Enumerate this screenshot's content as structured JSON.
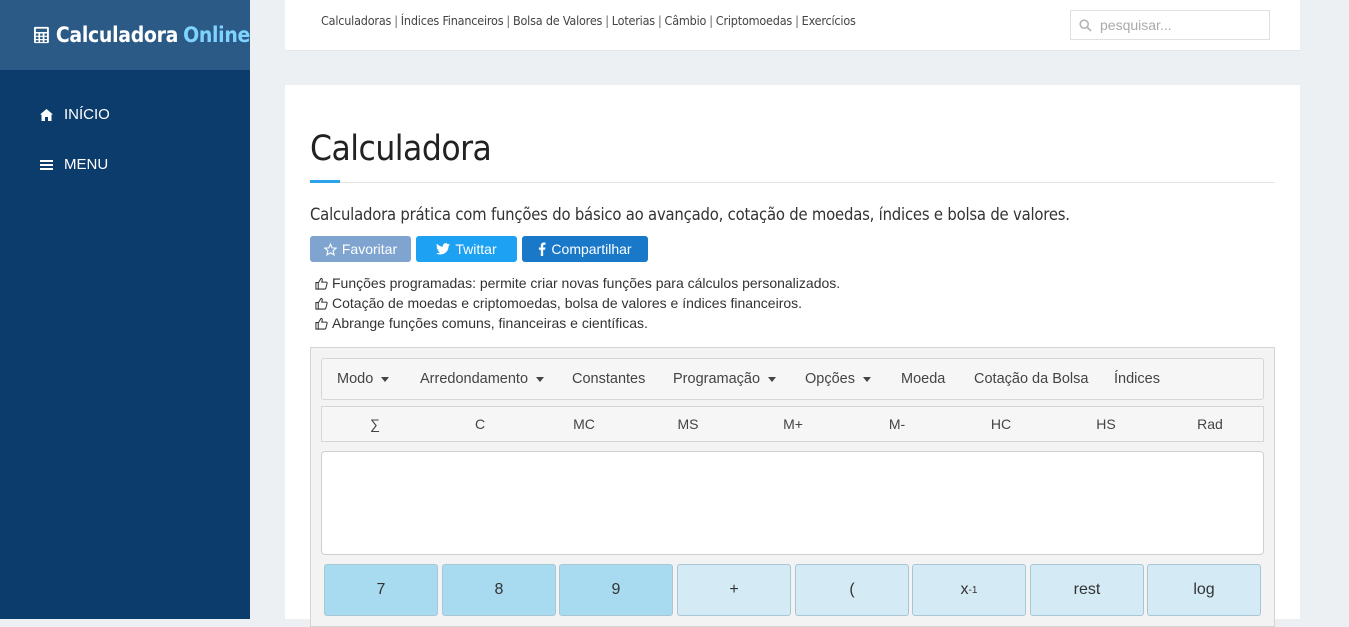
{
  "brand": {
    "name": "Calculadora",
    "accent": "Online"
  },
  "sidebar": {
    "items": [
      {
        "label": "INÍCIO",
        "icon": "home-icon"
      },
      {
        "label": "MENU",
        "icon": "hamburger-icon"
      }
    ]
  },
  "topnav": {
    "links": [
      "Calculadoras",
      "Índices Financeiros",
      "Bolsa de Valores",
      "Loterias",
      "Câmbio",
      "Criptomoedas",
      "Exercícios"
    ]
  },
  "search": {
    "placeholder": "pesquisar..."
  },
  "main": {
    "title": "Calculadora",
    "subtitle": "Calculadora prática com funções do básico ao avançado, cotação de moedas, índices e bolsa de valores.",
    "buttons": {
      "favorite": "Favoritar",
      "twitter": "Twittar",
      "share": "Compartilhar"
    },
    "features": [
      "Funções programadas: permite criar novas funções para cálculos personalizados.",
      "Cotação de moedas e criptomoedas, bolsa de valores e índices financeiros.",
      "Abrange funções comuns, financeiras e científicas."
    ]
  },
  "calculator": {
    "menu": [
      "Modo",
      "Arredondamento",
      "Constantes",
      "Programação",
      "Opções",
      "Moeda",
      "Cotação da Bolsa",
      "Índices"
    ],
    "memory": [
      "∑",
      "C",
      "MC",
      "MS",
      "M+",
      "M-",
      "HC",
      "HS",
      "Rad"
    ],
    "display": "",
    "keys": {
      "k7": "7",
      "k8": "8",
      "k9": "9",
      "plus": "+",
      "paren": "(",
      "inv_base": "x",
      "inv_exp": "-1",
      "rest": "rest",
      "log": "log"
    }
  },
  "colors": {
    "sidebar": "#0c3c6c",
    "logo_bg": "#2c5a86",
    "brand_accent": "#7fd3ff",
    "title_accent": "#2aa3e8",
    "favorite_btn": "#7ea4cf",
    "twitter_btn": "#1da1f2",
    "share_btn": "#1a78c9",
    "key_number": "#a8dbef",
    "key_operator": "#d4eaf5"
  }
}
